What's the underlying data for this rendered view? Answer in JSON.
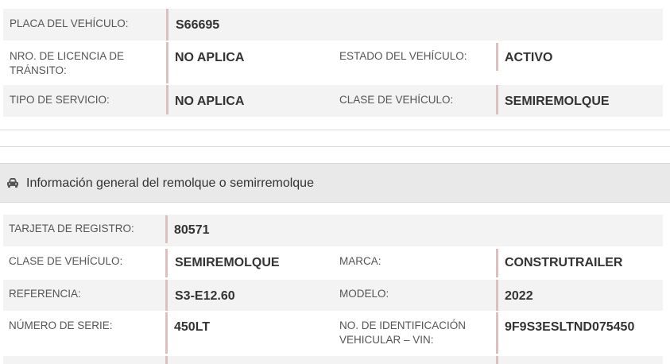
{
  "vehicle": {
    "placa_label": "PLACA DEL VEHÍCULO:",
    "placa_value": "S66695",
    "licencia_label_1": "NRO. DE LICENCIA DE",
    "licencia_label_2": "TRÁNSITO:",
    "licencia_value": "NO APLICA",
    "estado_label": "ESTADO DEL VEHÍCULO:",
    "estado_value": "ACTIVO",
    "servicio_label": "TIPO DE SERVICIO:",
    "servicio_value": "NO APLICA",
    "clase_label": "CLASE DE VEHÍCULO:",
    "clase_value": "SEMIREMOLQUE"
  },
  "section": {
    "title": "Información general del remolque o semirremolque",
    "icon": "car-icon"
  },
  "trailer": {
    "tarjeta_label": "TARJETA DE REGISTRO:",
    "tarjeta_value": "80571",
    "clase_label": "CLASE DE VEHÍCULO:",
    "clase_value": "SEMIREMOLQUE",
    "marca_label": "MARCA:",
    "marca_value": "CONSTRUTRAILER",
    "referencia_label": "REFERENCIA:",
    "referencia_value": "S3-E12.60",
    "modelo_label": "MODELO:",
    "modelo_value": "2022",
    "serie_label": "NÚMERO DE SERIE:",
    "serie_value": "450LT",
    "vin_label_1": "NO. DE IDENTIFICACIÓN",
    "vin_label_2": "VEHICULAR – VIN:",
    "vin_value": "9F9S3ESLTND075450"
  }
}
